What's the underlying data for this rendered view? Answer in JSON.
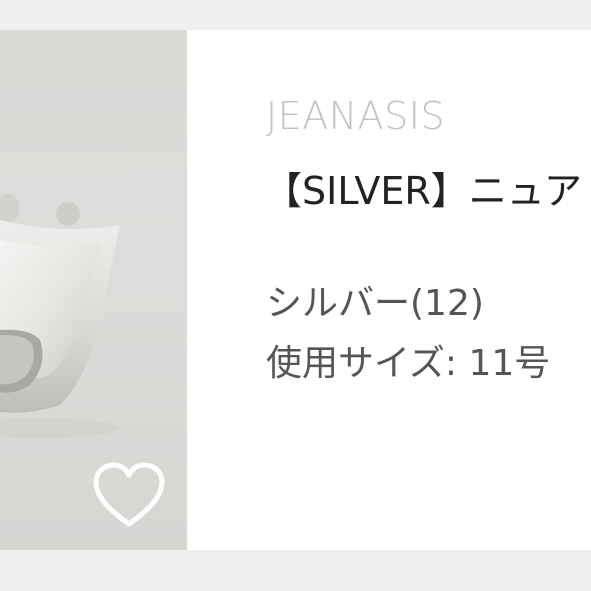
{
  "product": {
    "brand": "JEANASIS",
    "title": "【SILVER】ニュア",
    "color_text": "シルバー(12)",
    "size_text": "使用サイズ: 11号"
  },
  "icons": {
    "favorite": "heart-outline-icon"
  },
  "colors": {
    "background": "#f1efed",
    "card": "#ffffff",
    "brand_text": "#c3c3c3",
    "title_text": "#222222",
    "spec_text": "#555555"
  }
}
